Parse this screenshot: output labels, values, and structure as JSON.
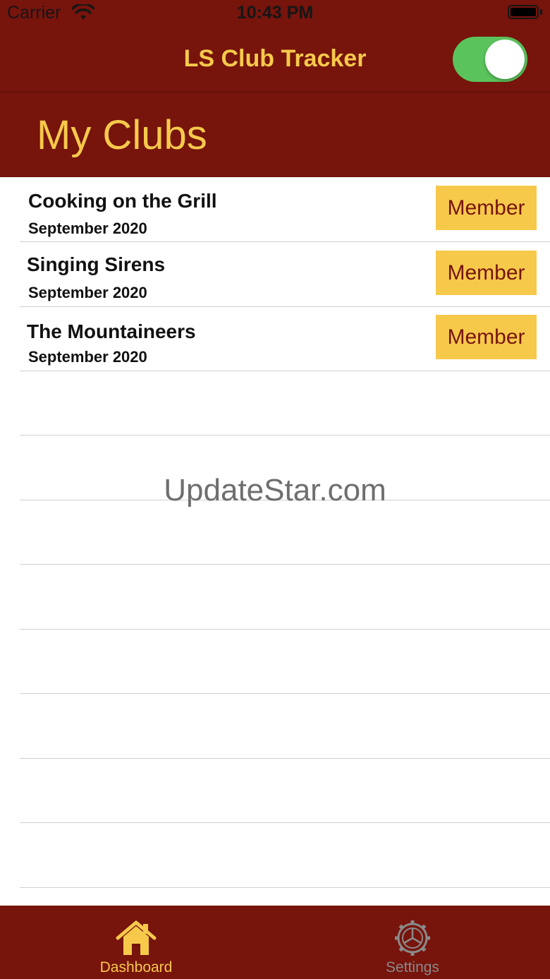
{
  "status_bar": {
    "carrier": "Carrier",
    "time": "10:43 PM"
  },
  "nav": {
    "title": "LS Club Tracker",
    "toggle_on": true
  },
  "header": {
    "title": "My Clubs"
  },
  "clubs": [
    {
      "name": "Cooking on the Grill",
      "date": "September 2020",
      "status": "Member"
    },
    {
      "name": "Singing Sirens",
      "date": "September 2020",
      "status": "Member"
    },
    {
      "name": "The Mountaineers",
      "date": "September 2020",
      "status": "Member"
    }
  ],
  "watermark": "UpdateStar.com",
  "tabs": [
    {
      "label": "Dashboard",
      "icon": "house-icon",
      "active": true
    },
    {
      "label": "Settings",
      "icon": "gear-icon",
      "active": false
    }
  ],
  "colors": {
    "brand": "#77140c",
    "accent": "#f6c94b",
    "toggle": "#5ac35c",
    "inactive_tab": "#8a8a8a"
  }
}
